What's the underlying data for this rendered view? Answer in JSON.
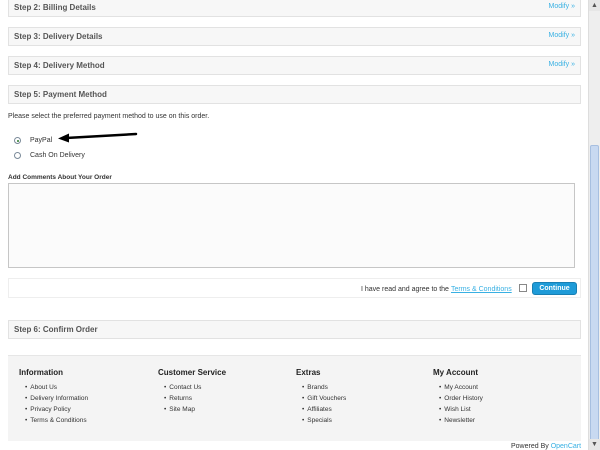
{
  "steps": [
    {
      "title": "Step 2: Billing Details",
      "modify": "Modify »"
    },
    {
      "title": "Step 3: Delivery Details",
      "modify": "Modify »"
    },
    {
      "title": "Step 4: Delivery Method",
      "modify": "Modify »"
    },
    {
      "title": "Step 5: Payment Method",
      "modify": ""
    },
    {
      "title": "Step 6: Confirm Order",
      "modify": ""
    }
  ],
  "payment": {
    "instruction": "Please select the preferred payment method to use on this order.",
    "options": [
      {
        "label": "PayPal",
        "selected": true
      },
      {
        "label": "Cash On Delivery",
        "selected": false
      }
    ]
  },
  "comments": {
    "label": "Add Comments About Your Order",
    "value": ""
  },
  "agreement": {
    "text": "I have read and agree to the",
    "link": "Terms & Conditions",
    "checked": false,
    "continue_label": "Continue"
  },
  "footer": {
    "columns": [
      {
        "title": "Information",
        "links": [
          "About Us",
          "Delivery Information",
          "Privacy Policy",
          "Terms & Conditions"
        ]
      },
      {
        "title": "Customer Service",
        "links": [
          "Contact Us",
          "Returns",
          "Site Map"
        ]
      },
      {
        "title": "Extras",
        "links": [
          "Brands",
          "Gift Vouchers",
          "Affiliates",
          "Specials"
        ]
      },
      {
        "title": "My Account",
        "links": [
          "My Account",
          "Order History",
          "Wish List",
          "Newsletter"
        ]
      }
    ],
    "powered_text": "Powered By",
    "powered_link": "OpenCart"
  },
  "colors": {
    "accent": "#38b0e3",
    "button": "#1e9bd8"
  },
  "icons": {
    "scroll_up": "scroll-up-arrow-icon",
    "scroll_down": "scroll-down-arrow-icon",
    "pointer": "arrow-pointer-icon"
  }
}
